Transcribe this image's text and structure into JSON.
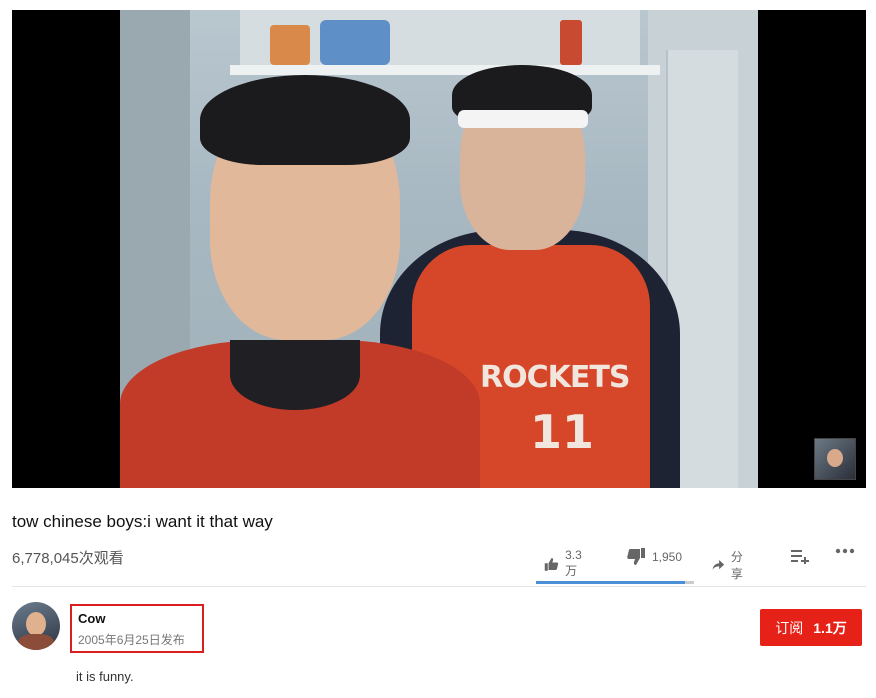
{
  "video": {
    "title": "tow chinese boys:i want it that way",
    "views": "6,778,045次观看",
    "jersey_text": "ROCKETS",
    "jersey_number": "11",
    "thumbnail_icon": "video-thumbnail"
  },
  "actions": {
    "like_count": "3.3万",
    "dislike_count": "1,950",
    "share_label": "分享",
    "like_ratio": 0.94
  },
  "channel": {
    "name": "Cow",
    "publish_date": "2005年6月25日发布",
    "subscribe_label": "订阅",
    "subscriber_count": "1.1万"
  },
  "description": "it is funny.",
  "colors": {
    "subscribe_red": "#e62117",
    "highlight_red": "#d9201f",
    "like_bar_blue": "#4b8fd6"
  }
}
